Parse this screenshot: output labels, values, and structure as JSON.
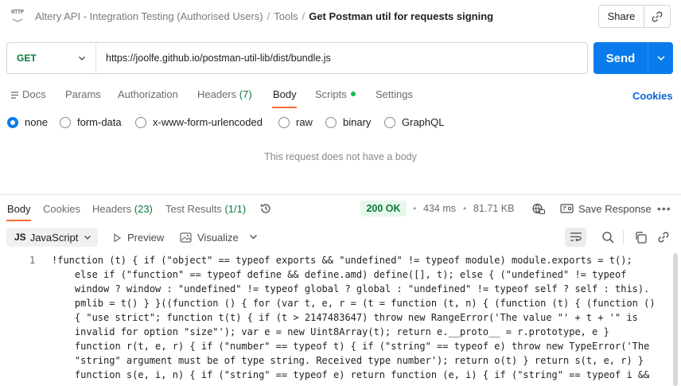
{
  "breadcrumb": {
    "workspace": "Altery API - Integration Testing (Authorised Users)",
    "folder": "Tools",
    "request": "Get Postman util for requests signing",
    "separator": "/"
  },
  "header": {
    "share_label": "Share",
    "icon_text": "HTTP"
  },
  "request": {
    "method": "GET",
    "url": "https://joolfe.github.io/postman-util-lib/dist/bundle.js",
    "send_label": "Send"
  },
  "request_tabs": [
    {
      "label": "Docs"
    },
    {
      "label": "Params"
    },
    {
      "label": "Authorization"
    },
    {
      "label": "Headers",
      "count": "(7)"
    },
    {
      "label": "Body"
    },
    {
      "label": "Scripts"
    },
    {
      "label": "Settings"
    }
  ],
  "cookies_link": "Cookies",
  "body_types": {
    "selected": "none",
    "options": [
      "none",
      "form-data",
      "x-www-form-urlencoded",
      "raw",
      "binary",
      "GraphQL"
    ]
  },
  "empty_body_message": "This request does not have a body",
  "response_tabs": [
    {
      "label": "Body"
    },
    {
      "label": "Cookies"
    },
    {
      "label": "Headers",
      "count": "(23)"
    },
    {
      "label": "Test Results",
      "count": "(1/1)"
    }
  ],
  "response_meta": {
    "status": "200 OK",
    "time": "434 ms",
    "size": "81.71 KB",
    "save_label": "Save Response"
  },
  "response_toolbar": {
    "language_badge": "JS",
    "language": "JavaScript",
    "preview_label": "Preview",
    "visualize_label": "Visualize"
  },
  "code": {
    "line_number": "1",
    "lines": [
      "!function (t) { if (\"object\" == typeof exports && \"undefined\" != typeof module) module.exports = t();",
      "    else if (\"function\" == typeof define && define.amd) define([], t); else { (\"undefined\" != typeof",
      "    window ? window : \"undefined\" != typeof global ? global : \"undefined\" != typeof self ? self : this).",
      "    pmlib = t() } }((function () { for (var t, e, r = (t = function (t, n) { (function (t) { (function ()",
      "    { \"use strict\"; function t(t) { if (t > 2147483647) throw new RangeError('The value \"' + t + '\" is",
      "    invalid for option \"size\"'); var e = new Uint8Array(t); return e.__proto__ = r.prototype, e }",
      "    function r(t, e, r) { if (\"number\" == typeof t) { if (\"string\" == typeof e) throw new TypeError('The",
      "    \"string\" argument must be of type string. Received type number'); return o(t) } return s(t, e, r) }",
      "    function s(e, i, n) { if (\"string\" == typeof e) return function (e, i) { if (\"string\" == typeof i &&"
    ]
  },
  "colors": {
    "accent_blue": "#097bed",
    "active_tab_underline": "#ff6c37",
    "method_green": "#0b7a3b",
    "status_bg": "#e6f7ec"
  }
}
